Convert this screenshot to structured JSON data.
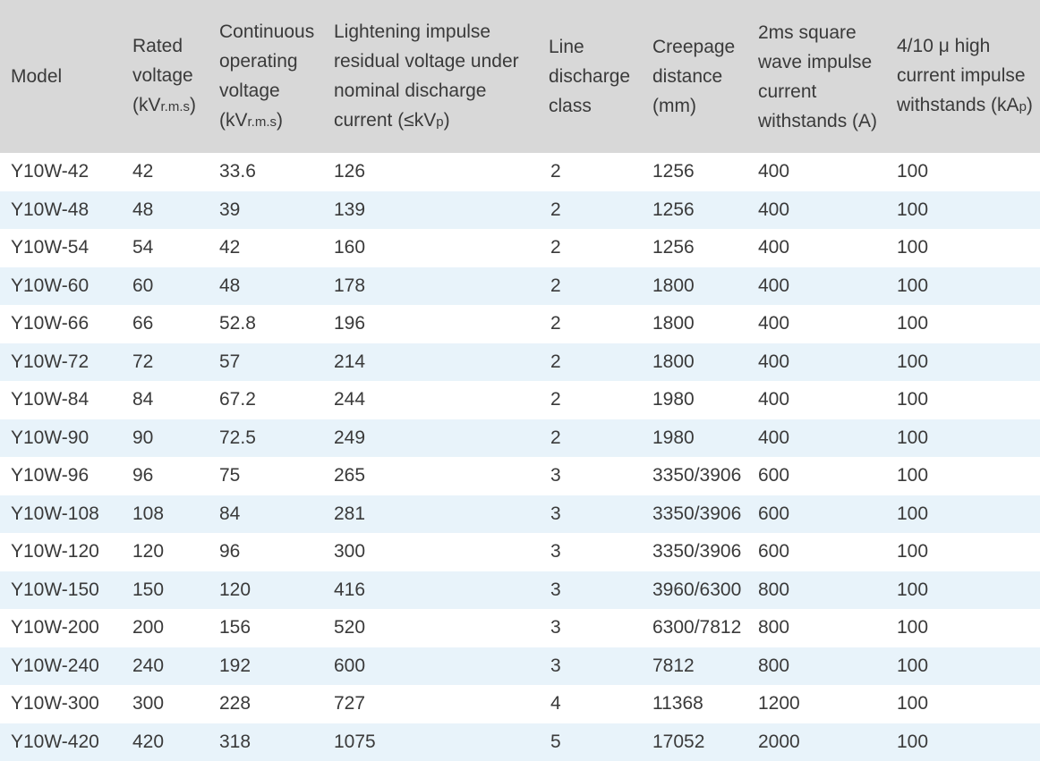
{
  "headers": {
    "model": "Model",
    "rated_l1": "Rated",
    "rated_l2": "voltage",
    "rated_l3_a": "(kV",
    "rated_l3_b": "r.m.s",
    "rated_l3_c": ")",
    "cont_l1": "Continuous",
    "cont_l2": "operating",
    "cont_l3": "voltage",
    "cont_l4_a": "(kV",
    "cont_l4_b": "r.m.s",
    "cont_l4_c": ")",
    "light_l1": "Lightening impulse",
    "light_l2": "residual voltage under",
    "light_l3": "nominal discharge",
    "light_l4_a": "current (≤kV",
    "light_l4_b": "p",
    "light_l4_c": ")",
    "line_l1": "Line",
    "line_l2": "discharge",
    "line_l3": "class",
    "creep_l1": "Creepage",
    "creep_l2": "distance",
    "creep_l3": "(mm)",
    "sq_l1": "2ms square",
    "sq_l2": "wave impulse",
    "sq_l3": "current",
    "sq_l4": "withstands (A)",
    "hc_l1": "4/10 μ high",
    "hc_l2": "current impulse",
    "hc_l3_a": "withstands (kA",
    "hc_l3_b": "p",
    "hc_l3_c": ")"
  },
  "rows": [
    [
      "Y10W-42",
      "42",
      "33.6",
      "126",
      "2",
      "1256",
      "400",
      "100"
    ],
    [
      "Y10W-48",
      "48",
      "39",
      "139",
      "2",
      "1256",
      "400",
      "100"
    ],
    [
      "Y10W-54",
      "54",
      "42",
      "160",
      "2",
      "1256",
      "400",
      "100"
    ],
    [
      "Y10W-60",
      "60",
      "48",
      "178",
      "2",
      "1800",
      "400",
      "100"
    ],
    [
      "Y10W-66",
      "66",
      "52.8",
      "196",
      "2",
      "1800",
      "400",
      "100"
    ],
    [
      "Y10W-72",
      "72",
      "57",
      "214",
      "2",
      "1800",
      "400",
      "100"
    ],
    [
      "Y10W-84",
      "84",
      "67.2",
      "244",
      "2",
      "1980",
      "400",
      "100"
    ],
    [
      "Y10W-90",
      "90",
      "72.5",
      "249",
      "2",
      "1980",
      "400",
      "100"
    ],
    [
      "Y10W-96",
      "96",
      "75",
      "265",
      "3",
      "3350/3906",
      "600",
      "100"
    ],
    [
      "Y10W-108",
      "108",
      "84",
      "281",
      "3",
      "3350/3906",
      "600",
      "100"
    ],
    [
      "Y10W-120",
      "120",
      "96",
      "300",
      "3",
      "3350/3906",
      "600",
      "100"
    ],
    [
      "Y10W-150",
      "150",
      "120",
      "416",
      "3",
      "3960/6300",
      "800",
      "100"
    ],
    [
      "Y10W-200",
      "200",
      "156",
      "520",
      "3",
      "6300/7812",
      "800",
      "100"
    ],
    [
      "Y10W-240",
      "240",
      "192",
      "600",
      "3",
      "7812",
      "800",
      "100"
    ],
    [
      "Y10W-300",
      "300",
      "228",
      "727",
      "4",
      "11368",
      "1200",
      "100"
    ],
    [
      "Y10W-420",
      "420",
      "318",
      "1075",
      "5",
      "17052",
      "2000",
      "100"
    ]
  ],
  "colors": {
    "header_bg": "#d8d8d8",
    "stripe_bg": "#e8f3fa",
    "text": "#3a3a3a"
  }
}
